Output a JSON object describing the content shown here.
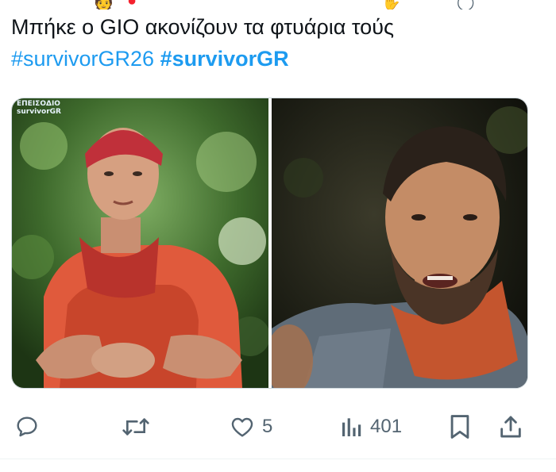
{
  "tweet": {
    "text": "Μπήκε ο GIO  ακονίζουν τα φτυάρια τούς",
    "hashtags": [
      "#survivorGR26",
      "#survivorGR"
    ]
  },
  "media": {
    "left_photo": {
      "overlay": "ΕΠΕΙΣΟΔΙΟ\nsurvivorGR",
      "description_icon": "photo"
    },
    "right_photo": {
      "description_icon": "photo"
    }
  },
  "actions": {
    "reply": {
      "icon": "reply-icon"
    },
    "retweet": {
      "icon": "retweet-icon"
    },
    "like": {
      "icon": "heart-icon",
      "count": "5"
    },
    "views": {
      "icon": "views-icon",
      "count": "401"
    },
    "bookmark": {
      "icon": "bookmark-icon"
    },
    "share": {
      "icon": "share-icon"
    }
  },
  "colors": {
    "hashtag": "#1d9bf0",
    "icon": "#536471",
    "text": "#0f1419"
  }
}
